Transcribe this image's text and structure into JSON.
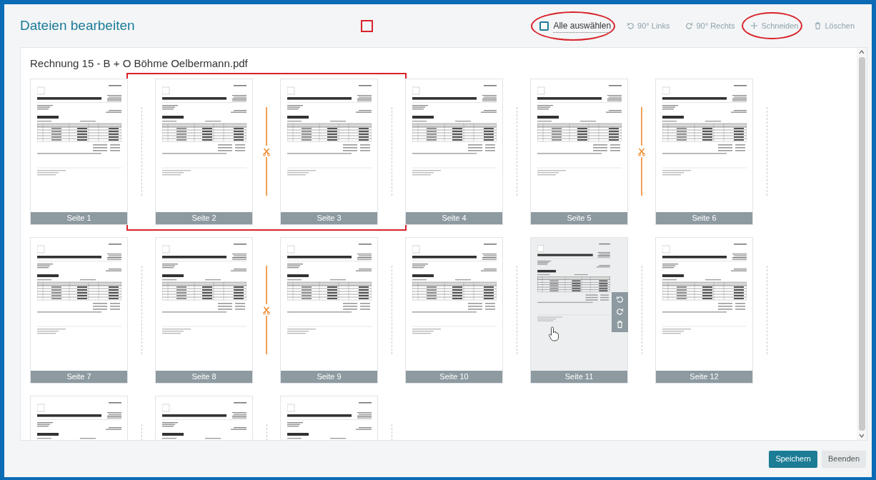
{
  "header": {
    "title": "Dateien bearbeiten",
    "title_marked": true
  },
  "toolbar": [
    {
      "kind": "checkbox",
      "label": "Alle auswählen",
      "checked": false,
      "disabled": false,
      "circled": true
    },
    {
      "kind": "rotate-left",
      "label": "90° Links",
      "disabled": true,
      "circled": false
    },
    {
      "kind": "rotate-right",
      "label": "90° Rechts",
      "disabled": true,
      "circled": false
    },
    {
      "kind": "cut",
      "label": "Schneiden",
      "disabled": true,
      "circled": true
    },
    {
      "kind": "delete",
      "label": "Löschen",
      "disabled": true,
      "circled": false
    }
  ],
  "document": {
    "filename": "Rechnung 15 - B + O Böhme Oelbermann.pdf",
    "rows": [
      [
        {
          "label": "Seite 1",
          "divider_after": true,
          "cut_after": false,
          "marked": false,
          "hovered": false
        },
        {
          "label": "Seite 2",
          "divider_after": true,
          "cut_after": true,
          "marked": true,
          "hovered": false
        },
        {
          "label": "Seite 3",
          "divider_after": true,
          "cut_after": false,
          "marked": true,
          "hovered": false
        },
        {
          "label": "Seite 4",
          "divider_after": true,
          "cut_after": false,
          "marked": false,
          "hovered": false
        },
        {
          "label": "Seite 5",
          "divider_after": true,
          "cut_after": true,
          "marked": false,
          "hovered": false
        },
        {
          "label": "Seite 6",
          "divider_after": true,
          "cut_after": false,
          "marked": false,
          "hovered": false
        }
      ],
      [
        {
          "label": "Seite 7",
          "divider_after": true,
          "cut_after": false,
          "marked": false,
          "hovered": false
        },
        {
          "label": "Seite 8",
          "divider_after": true,
          "cut_after": true,
          "marked": false,
          "hovered": false
        },
        {
          "label": "Seite 9",
          "divider_after": true,
          "cut_after": false,
          "marked": false,
          "hovered": false
        },
        {
          "label": "Seite 10",
          "divider_after": true,
          "cut_after": false,
          "marked": false,
          "hovered": false
        },
        {
          "label": "Seite 11",
          "divider_after": true,
          "cut_after": false,
          "marked": false,
          "hovered": true
        },
        {
          "label": "Seite 12",
          "divider_after": true,
          "cut_after": false,
          "marked": false,
          "hovered": false
        }
      ],
      [
        {
          "divider_after": true,
          "cut_after": false,
          "marked": false,
          "hovered": false
        },
        {
          "divider_after": true,
          "cut_after": false,
          "marked": false,
          "hovered": false
        },
        {
          "divider_after": true,
          "cut_after": false,
          "marked": false,
          "hovered": false
        }
      ]
    ]
  },
  "footer": {
    "buttons": [
      {
        "kind": "primary",
        "label": "Speichern"
      },
      {
        "kind": "secondary",
        "label": "Beenden"
      }
    ]
  }
}
